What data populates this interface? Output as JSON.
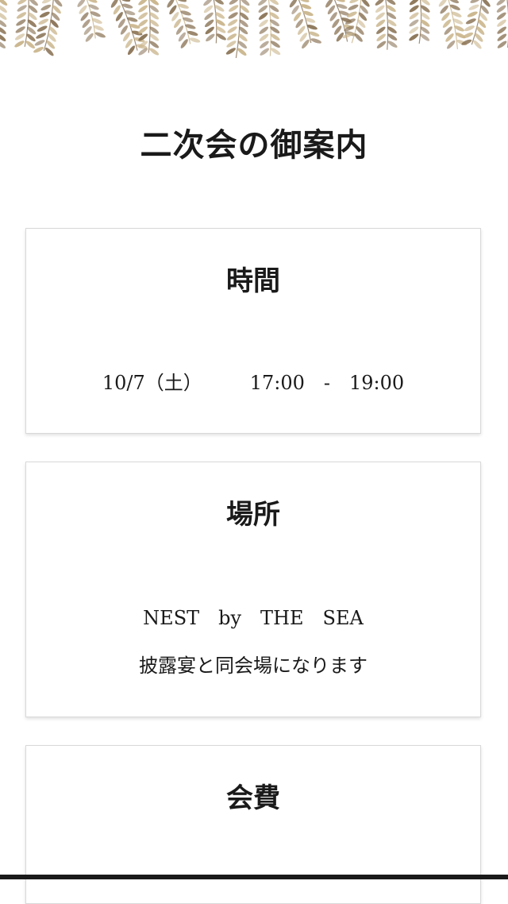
{
  "page_title": "二次会の御案内",
  "colors": {
    "leaf_gold": "#c9b48a",
    "leaf_brown": "#8a7355",
    "card_border": "#d9d9d9",
    "text": "#1a1a1a"
  },
  "cards": [
    {
      "heading": "時間",
      "date": "10/7（土）",
      "start": "17:00",
      "separator": "-",
      "end": "19:00"
    },
    {
      "heading": "場所",
      "venue": "NEST　by　THE　SEA",
      "note": "披露宴と同会場になります"
    },
    {
      "heading": "会費"
    }
  ],
  "decoration": {
    "banner_icon": "leaf-garland-icon"
  }
}
